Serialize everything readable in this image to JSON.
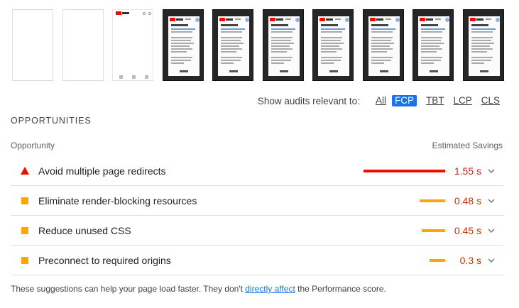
{
  "filter": {
    "label": "Show audits relevant to:",
    "options": [
      "All",
      "FCP",
      "TBT",
      "LCP",
      "CLS"
    ],
    "active": "FCP"
  },
  "section": {
    "title": "OPPORTUNITIES",
    "col_opportunity": "Opportunity",
    "col_savings": "Estimated Savings"
  },
  "opportunities": [
    {
      "title": "Avoid multiple page redirects",
      "savings": "1.55 s",
      "icon": "fail-triangle-icon",
      "color": "#eb0f00",
      "text_color": "#c5221f",
      "bar_fraction": 1.0
    },
    {
      "title": "Eliminate render-blocking resources",
      "savings": "0.48 s",
      "icon": "average-square-icon",
      "color": "#ffa400",
      "text_color": "#c33300",
      "bar_fraction": 0.31
    },
    {
      "title": "Reduce unused CSS",
      "savings": "0.45 s",
      "icon": "average-square-icon",
      "color": "#ffa400",
      "text_color": "#c33300",
      "bar_fraction": 0.29
    },
    {
      "title": "Preconnect to required origins",
      "savings": "0.3 s",
      "icon": "average-square-icon",
      "color": "#ffa400",
      "text_color": "#c33300",
      "bar_fraction": 0.19
    }
  ],
  "footer": {
    "before": "These suggestions can help your page load faster. They don't ",
    "link": "directly affect",
    "after": " the Performance score."
  }
}
